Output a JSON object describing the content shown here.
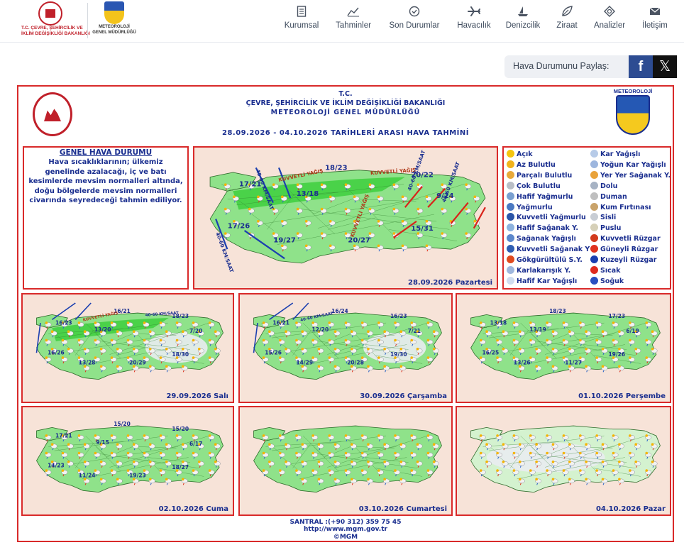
{
  "header": {
    "ministry_logo_lines": [
      "T.C. ÇEVRE, ŞEHİRCİLİK VE",
      "İKLİM DEĞİŞİKLİĞİ BAKANLIĞI"
    ],
    "mgm_logo_lines": [
      "METEOROLOJİ",
      "GENEL MÜDÜRLÜĞÜ"
    ],
    "nav": [
      {
        "label": "Kurumsal",
        "icon": "document-icon"
      },
      {
        "label": "Tahminler",
        "icon": "chart-icon"
      },
      {
        "label": "Son Durumlar",
        "icon": "check-circle-icon"
      },
      {
        "label": "Havacılık",
        "icon": "plane-icon"
      },
      {
        "label": "Denizcilik",
        "icon": "sailboat-icon"
      },
      {
        "label": "Ziraat",
        "icon": "leaf-icon"
      },
      {
        "label": "Analizler",
        "icon": "analysis-icon"
      },
      {
        "label": "İletişim",
        "icon": "envelope-icon"
      }
    ]
  },
  "share": {
    "label": "Hava Durumunu Paylaş:",
    "facebook": "f",
    "x": "𝕏"
  },
  "bulletin": {
    "title_lines": [
      "T.C.",
      "ÇEVRE, ŞEHİRCİLİK VE İKLİM DEĞİŞİKLİĞİ BAKANLIĞI",
      "METEOROLOJİ GENEL MÜDÜRLÜĞÜ"
    ],
    "period": "28.09.2026 - 04.10.2026 TARİHLERİ ARASI HAVA TAHMİNİ",
    "mgm_badge": "METEOROLOJİ",
    "general": {
      "title": "GENEL HAVA DURUMU",
      "text": "Hava sıcaklıklarının; ülkemiz genelinde azalacağı, iç ve batı kesimlerde mevsim normalleri altında, doğu bölgelerde mevsim normalleri civarında seyredeceği tahmin ediliyor."
    },
    "maps": [
      {
        "date": "28.09.2026 Pazartesi",
        "temps": [
          "18/23",
          "20/22",
          "17/21",
          "13/18",
          "9/24",
          "17/26",
          "15/31",
          "19/27",
          "20/27"
        ],
        "labels": [
          "KUVVETLİ YAĞIŞ",
          "KUVVETLİ YAĞIŞ",
          "KUVVETLİ YAĞIŞ",
          "40-60 KM/SAAT",
          "40-60 KM/SAAT",
          "40-60 KM/SAAT",
          "40-60 KM/SAAT"
        ]
      },
      {
        "date": "29.09.2026 Salı",
        "temps": [
          "16/21",
          "18/23",
          "16/23",
          "13/20",
          "7/20",
          "16/26",
          "18/30",
          "13/28",
          "20/29"
        ],
        "labels": [
          "KUVVETLİ YAĞIŞ",
          "40-60 KM/SAAT"
        ]
      },
      {
        "date": "30.09.2026 Çarşamba",
        "temps": [
          "16/24",
          "16/23",
          "16/21",
          "12/20",
          "7/21",
          "15/26",
          "19/30",
          "14/29",
          "20/28"
        ],
        "labels": [
          "40-60 KM/SAAT"
        ]
      },
      {
        "date": "01.10.2026 Perşembe",
        "temps": [
          "18/23",
          "17/23",
          "13/18",
          "13/19",
          "6/19",
          "16/25",
          "19/26",
          "13/26",
          "11/27"
        ],
        "labels": []
      },
      {
        "date": "02.10.2026 Cuma",
        "temps": [
          "15/20",
          "15/20",
          "17/21",
          "9/15",
          "6/17",
          "14/23",
          "18/27",
          "11/24",
          "19/23"
        ],
        "labels": []
      },
      {
        "date": "03.10.2026 Cumartesi",
        "temps": [],
        "labels": []
      },
      {
        "date": "04.10.2026 Pazar",
        "temps": [],
        "labels": []
      }
    ],
    "legend": [
      {
        "label": "Açık",
        "color": "#f5c50f"
      },
      {
        "label": "Az Bulutlu",
        "color": "#f2b31d"
      },
      {
        "label": "Parçalı Bulutlu",
        "color": "#e8a93a"
      },
      {
        "label": "Çok Bulutlu",
        "color": "#b9bec6"
      },
      {
        "label": "Hafif Yağmurlu",
        "color": "#7aa0d0"
      },
      {
        "label": "Yağmurlu",
        "color": "#4b79c2"
      },
      {
        "label": "Kuvvetli Yağmurlu",
        "color": "#2b55a8"
      },
      {
        "label": "Hafif Sağanak Y.",
        "color": "#8db2de"
      },
      {
        "label": "Sağanak Yağışlı",
        "color": "#5c88cc"
      },
      {
        "label": "Kuvvetli Sağanak Y",
        "color": "#2f5eb3"
      },
      {
        "label": "Gökgürültülü S.Y.",
        "color": "#e04a1e"
      },
      {
        "label": "Karlakarışık Y.",
        "color": "#9fb7dd"
      },
      {
        "label": "Hafif Kar Yağışlı",
        "color": "#cfdcf0"
      },
      {
        "label": "Kar Yağışlı",
        "color": "#b7cbe8"
      },
      {
        "label": "Yoğun Kar Yağışlı",
        "color": "#9db6de"
      },
      {
        "label": "Yer Yer Sağanak Y.",
        "color": "#e9a33b"
      },
      {
        "label": "Dolu",
        "color": "#a7b3c4"
      },
      {
        "label": "Duman",
        "color": "#bfbfbf"
      },
      {
        "label": "Kum Fırtınası",
        "color": "#c9a36a"
      },
      {
        "label": "Sisli",
        "color": "#c8cdd4"
      },
      {
        "label": "Puslu",
        "color": "#d6d0b8"
      },
      {
        "label": "Kuvvetli Rüzgar",
        "color": "#d23a1c"
      },
      {
        "label": "Güneyli Rüzgar",
        "color": "#e0321e"
      },
      {
        "label": "Kuzeyli Rüzgar",
        "color": "#1b3fb0"
      },
      {
        "label": "Sıcak",
        "color": "#e02b1e"
      },
      {
        "label": "Soğuk",
        "color": "#2a4fc0"
      }
    ],
    "footer": [
      "SANTRAL :(+90 312) 359 75 45",
      "http://www.mgm.gov.tr",
      "©MGM"
    ]
  }
}
